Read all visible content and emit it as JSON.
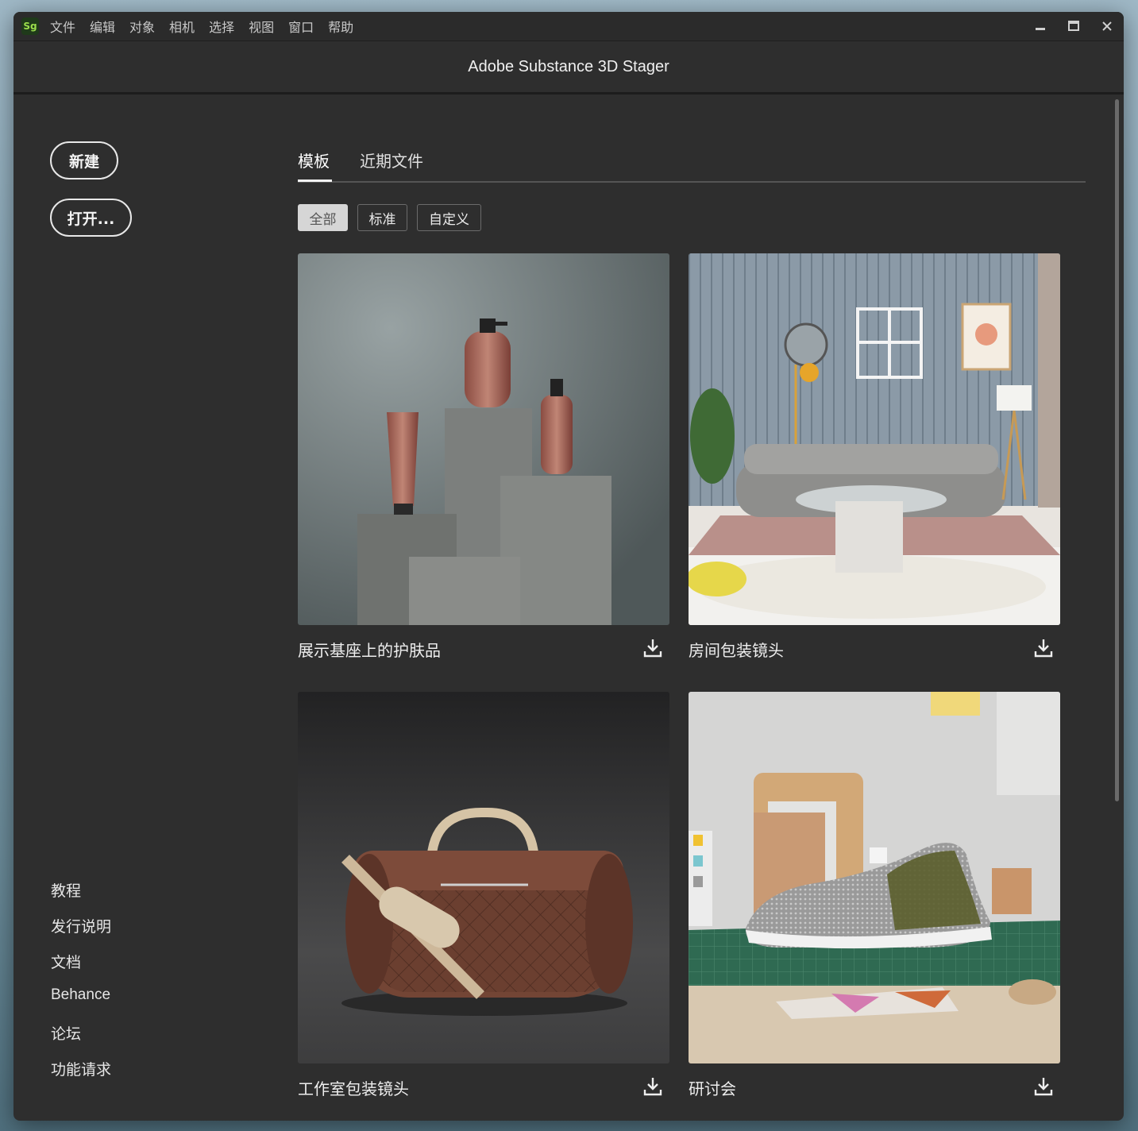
{
  "app": {
    "logo": "Sg",
    "title": "Adobe Substance 3D Stager",
    "menu": [
      "文件",
      "编辑",
      "对象",
      "相机",
      "选择",
      "视图",
      "窗口",
      "帮助"
    ]
  },
  "window_controls": {
    "minimize": "minimize-icon",
    "maximize": "maximize-icon",
    "close": "close-icon"
  },
  "sidebar": {
    "new_label": "新建",
    "open_label": "打开...",
    "links": [
      "教程",
      "发行说明",
      "文档",
      "Behance",
      "论坛",
      "功能请求"
    ]
  },
  "tabs": [
    {
      "label": "模板",
      "active": true
    },
    {
      "label": "近期文件",
      "active": false
    }
  ],
  "filters": [
    {
      "label": "全部",
      "selected": true
    },
    {
      "label": "标准",
      "selected": false
    },
    {
      "label": "自定义",
      "selected": false
    }
  ],
  "templates": [
    {
      "title": "展示基座上的护肤品",
      "icon": "download-icon"
    },
    {
      "title": "房间包装镜头",
      "icon": "download-icon"
    },
    {
      "title": "工作室包装镜头",
      "icon": "download-icon"
    },
    {
      "title": "研讨会",
      "icon": "download-icon"
    }
  ],
  "colors": {
    "window_bg": "#2e2e2e",
    "accent_logo": "#9bde4c"
  }
}
